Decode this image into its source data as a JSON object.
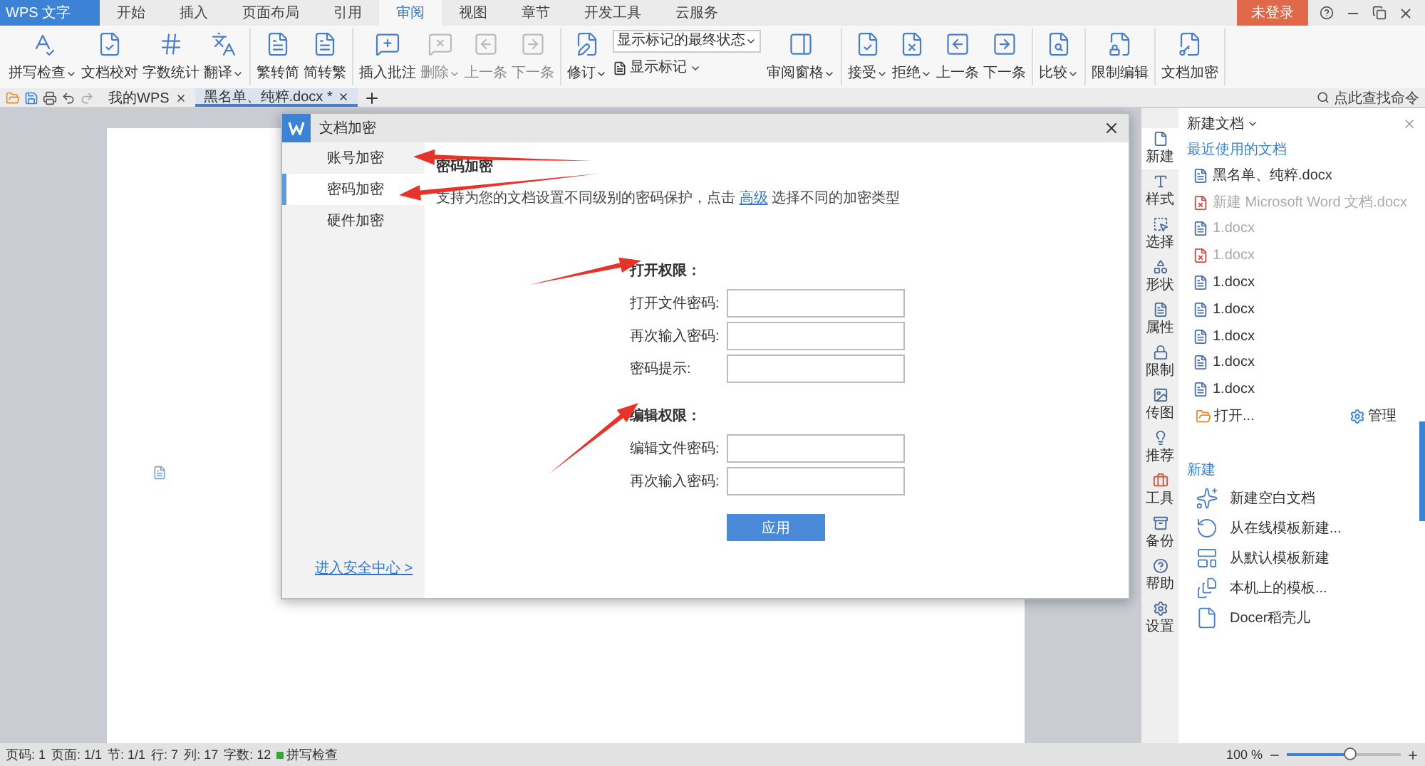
{
  "title_bar": {
    "app_button": "WPS 文字",
    "tabs": [
      {
        "label": "开始",
        "selected": false
      },
      {
        "label": "插入",
        "selected": false
      },
      {
        "label": "页面布局",
        "selected": false
      },
      {
        "label": "引用",
        "selected": false
      },
      {
        "label": "审阅",
        "selected": true
      },
      {
        "label": "视图",
        "selected": false
      },
      {
        "label": "章节",
        "selected": false
      },
      {
        "label": "开发工具",
        "selected": false
      },
      {
        "label": "云服务",
        "selected": false
      }
    ],
    "login": "未登录"
  },
  "ribbon": {
    "groups": [
      {
        "items": [
          {
            "kind": "large",
            "label": "拼写检查",
            "dropdown": true,
            "disabled": false
          },
          {
            "kind": "large",
            "label": "文档校对",
            "dropdown": false,
            "disabled": false
          },
          {
            "kind": "large",
            "label": "字数统计",
            "dropdown": false,
            "disabled": false
          },
          {
            "kind": "large",
            "label": "翻译",
            "dropdown": true,
            "disabled": false
          }
        ]
      },
      {
        "items": [
          {
            "kind": "large",
            "label": "繁转简",
            "dropdown": false,
            "disabled": false
          },
          {
            "kind": "large",
            "label": "简转繁",
            "dropdown": false,
            "disabled": false
          }
        ]
      },
      {
        "items": [
          {
            "kind": "large",
            "label": "插入批注",
            "dropdown": false,
            "disabled": false
          },
          {
            "kind": "large",
            "label": "删除",
            "dropdown": true,
            "disabled": true
          },
          {
            "kind": "large",
            "label": "上一条",
            "dropdown": false,
            "disabled": true
          },
          {
            "kind": "large",
            "label": "下一条",
            "dropdown": false,
            "disabled": true
          }
        ]
      },
      {
        "items": [
          {
            "kind": "large",
            "label": "修订",
            "dropdown": true,
            "disabled": false
          },
          {
            "kind": "stack",
            "select": "显示标记的最终状态",
            "label": "显示标记",
            "dropdown": true
          },
          {
            "kind": "large",
            "label": "审阅窗格",
            "dropdown": true,
            "disabled": false
          }
        ]
      },
      {
        "items": [
          {
            "kind": "large",
            "label": "接受",
            "dropdown": true,
            "disabled": false
          },
          {
            "kind": "large",
            "label": "拒绝",
            "dropdown": true,
            "disabled": false
          },
          {
            "kind": "large",
            "label": "上一条",
            "dropdown": false,
            "disabled": false
          },
          {
            "kind": "large",
            "label": "下一条",
            "dropdown": false,
            "disabled": false
          }
        ]
      },
      {
        "items": [
          {
            "kind": "large",
            "label": "比较",
            "dropdown": true,
            "disabled": false
          }
        ]
      },
      {
        "items": [
          {
            "kind": "large",
            "label": "限制编辑",
            "dropdown": false,
            "disabled": false
          }
        ]
      },
      {
        "items": [
          {
            "kind": "large",
            "label": "文档加密",
            "dropdown": false,
            "disabled": false
          }
        ]
      }
    ]
  },
  "doc_tabs": [
    {
      "label": "我的WPS",
      "selected": false
    },
    {
      "label": "黑名单、纯粹.docx *",
      "selected": true
    }
  ],
  "command_search": {
    "placeholder": "点此查找命令"
  },
  "dialog": {
    "title": "文档加密",
    "nav": [
      {
        "label": "账号加密",
        "selected": false
      },
      {
        "label": "密码加密",
        "selected": true
      },
      {
        "label": "硬件加密",
        "selected": false
      }
    ],
    "heading": "密码加密",
    "description": "支持为您的文档设置不同级别的密码保护，点击",
    "link": "高级",
    "description_end": "选择不同的加密类型",
    "sections": [
      {
        "title": "打开权限：",
        "fields": [
          "打开文件密码:",
          "再次输入密码:",
          "密码提示:"
        ]
      },
      {
        "title": "编辑权限：",
        "fields": [
          "编辑文件密码:",
          "再次输入密码:"
        ]
      }
    ],
    "apply_button": "应用",
    "footer_link": "进入安全中心 >"
  },
  "task_pane": {
    "header": "新建文档",
    "side_tabs": [
      {
        "label": "新建",
        "selected": true
      },
      {
        "label": "样式",
        "selected": false
      },
      {
        "label": "选择",
        "selected": false
      },
      {
        "label": "形状",
        "selected": false
      },
      {
        "label": "属性",
        "selected": false
      },
      {
        "label": "限制",
        "selected": false
      },
      {
        "label": "传图",
        "selected": false
      },
      {
        "label": "推荐",
        "selected": false
      },
      {
        "label": "工具",
        "selected": false
      },
      {
        "label": "备份",
        "selected": false
      },
      {
        "label": "帮助",
        "selected": false
      },
      {
        "label": "设置",
        "selected": false
      }
    ],
    "recent_title": "最近使用的文档",
    "recent": [
      {
        "name": "黑名单、纯粹.docx",
        "kind": "word",
        "faded": false
      },
      {
        "name": "新建 Microsoft Word 文档.docx",
        "kind": "broken",
        "faded": true
      },
      {
        "name": "1.docx",
        "kind": "word",
        "faded": true
      },
      {
        "name": "1.docx",
        "kind": "broken",
        "faded": true
      },
      {
        "name": "1.docx",
        "kind": "word",
        "faded": false
      },
      {
        "name": "1.docx",
        "kind": "word",
        "faded": false
      },
      {
        "name": "1.docx",
        "kind": "word",
        "faded": false
      },
      {
        "name": "1.docx",
        "kind": "word",
        "faded": false
      },
      {
        "name": "1.docx",
        "kind": "word",
        "faded": false
      }
    ],
    "open": "打开...",
    "manage": "管理",
    "new_title": "新建",
    "new_items": [
      "新建空白文档",
      "从在线模板新建...",
      "从默认模板新建",
      "本机上的模板...",
      "Docer稻壳儿"
    ]
  },
  "status_bar": {
    "items": [
      "页码: 1",
      "页面: 1/1",
      "节: 1/1",
      "行: 7",
      "列: 17",
      "字数: 12"
    ],
    "spell": "拼写检查",
    "zoom": "100 %",
    "zoom_slider": {
      "level": 0.55
    }
  }
}
